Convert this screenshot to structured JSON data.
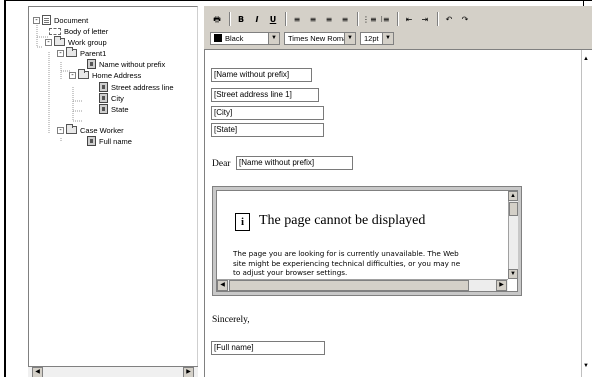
{
  "tree": {
    "nodes": [
      {
        "label": "Document"
      },
      {
        "label": "Body of letter"
      },
      {
        "label": "Work group"
      },
      {
        "label": "Parent1"
      },
      {
        "label": "Name without prefix"
      },
      {
        "label": "Home Address"
      },
      {
        "label": "Street address line"
      },
      {
        "label": "City"
      },
      {
        "label": "State"
      },
      {
        "label": "Case Worker"
      },
      {
        "label": "Full name"
      }
    ]
  },
  "toolbar": {
    "print_glyph": "🖶",
    "bold": "B",
    "italic": "I",
    "underline": "U",
    "align_left": "≡",
    "align_center": "≡",
    "align_right": "≡",
    "justify": "≡",
    "numbered_list": "⋮≡",
    "bullet_list": "⁝≡",
    "outdent": "⇤",
    "indent": "⇥",
    "undo": "↶",
    "redo": "↷",
    "color_value": "Black",
    "font_value": "Times New Roman",
    "size_value": "12pt"
  },
  "document": {
    "fields": {
      "name": "[Name without prefix]",
      "street": "[Street address line 1]",
      "city": "[City]",
      "state": "[State]",
      "dear_name": "[Name without prefix]",
      "full_name": "[Full name]"
    },
    "dear": "Dear",
    "sincerely": "Sincerely,",
    "error": {
      "icon_glyph": "i",
      "title": "The page cannot be displayed",
      "line1": "The page you are looking for is currently unavailable. The Web",
      "line2": "site might be experiencing technical difficulties, or you may ne",
      "line3": "to adjust your browser settings."
    }
  },
  "scroll_glyphs": {
    "left": "◀",
    "right": "▶",
    "up": "▲",
    "down": "▼"
  },
  "colors": {
    "toolbar_bg": "#d4d0c8",
    "text_color_swatch": "#000000"
  }
}
